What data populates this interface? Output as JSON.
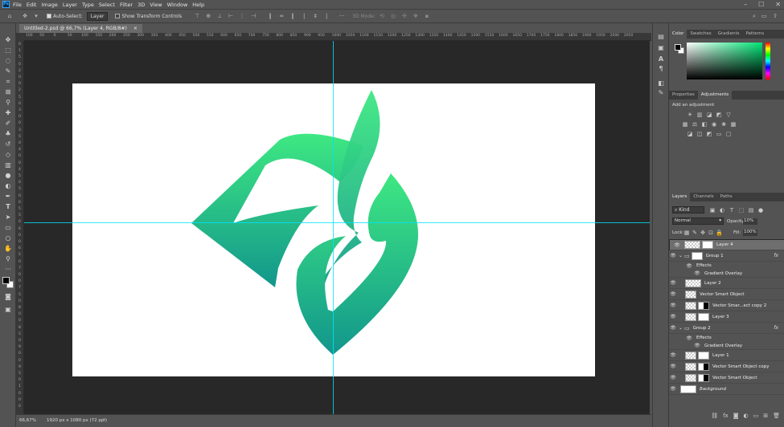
{
  "app": {
    "logo": "Ps"
  },
  "menu": [
    "File",
    "Edit",
    "Image",
    "Layer",
    "Type",
    "Select",
    "Filter",
    "3D",
    "View",
    "Window",
    "Help"
  ],
  "window_controls": [
    "–",
    "☐",
    "✕"
  ],
  "options_bar": {
    "auto_select_label": "Auto-Select:",
    "auto_select_value": "Layer",
    "transform_label": "Show Transform Controls",
    "mode_3d_label": "3D Mode:"
  },
  "document": {
    "tab_title": "Untitled-2.psd @ 66,7% (Layer 4, RGB/8#)",
    "tab_close": "×",
    "zoom": "66,67%",
    "doc_info": "1920 px x 1080 px (72 ppi)"
  },
  "ruler_top_ticks": [
    "100",
    "50",
    "0",
    "50",
    "100",
    "150",
    "200",
    "250",
    "300",
    "350",
    "400",
    "450",
    "500",
    "550",
    "600",
    "650",
    "700",
    "750",
    "800",
    "850",
    "900",
    "950",
    "1000",
    "1050",
    "1100",
    "1150",
    "1200",
    "1250",
    "1300",
    "1350",
    "1400",
    "1450",
    "1500",
    "1550",
    "1600",
    "1650",
    "1700",
    "1750",
    "1800",
    "1850",
    "1900",
    "1950",
    "2000",
    "2050"
  ],
  "ruler_left_ticks": [
    "0",
    "1",
    "5",
    "0",
    "2",
    "0",
    "0",
    "2",
    "5",
    "0",
    "3",
    "0",
    "0",
    "3",
    "5",
    "0",
    "4",
    "0",
    "0",
    "4",
    "5",
    "0",
    "5",
    "0",
    "0",
    "5",
    "5",
    "0",
    "6",
    "0",
    "0",
    "6",
    "5",
    "0",
    "7",
    "0",
    "0",
    "7",
    "5",
    "0",
    "8",
    "0",
    "0",
    "8",
    "5",
    "0",
    "9",
    "0",
    "0",
    "9",
    "5",
    "0",
    "1",
    "0",
    "0",
    "0"
  ],
  "color_panel": {
    "tabs": [
      "Color",
      "Swatches",
      "Gradients",
      "Patterns"
    ],
    "accent": "#00e676"
  },
  "properties_panel": {
    "tabs": [
      "Properties",
      "Adjustments"
    ],
    "add_label": "Add an adjustment"
  },
  "layers_panel": {
    "tabs": [
      "Layers",
      "Channels",
      "Paths"
    ],
    "filter_kind": "Kind",
    "blend_mode": "Normal",
    "opacity_label": "Opacity:",
    "opacity_value": "10%",
    "lock_label": "Lock:",
    "fill_label": "Fill:",
    "fill_value": "100%",
    "layers": [
      {
        "name": "Layer 4",
        "selected": true
      },
      {
        "name": "Group 1",
        "fx": "fx"
      },
      {
        "name": "Effects"
      },
      {
        "name": "Gradient Overlay"
      },
      {
        "name": "Layer 2"
      },
      {
        "name": "Vector Smart Object"
      },
      {
        "name": "Vector Smar...ect copy 2"
      },
      {
        "name": "Layer 3"
      },
      {
        "name": "Group 2",
        "fx": "fx"
      },
      {
        "name": "Effects"
      },
      {
        "name": "Gradient Overlay"
      },
      {
        "name": "Layer 1"
      },
      {
        "name": "Vector Smart Object copy"
      },
      {
        "name": "Vector Smart Object"
      },
      {
        "name": "Background"
      }
    ]
  },
  "colors": {
    "gradient_top": "#3ee882",
    "gradient_bottom": "#12968c",
    "guide": "#00e5ff"
  }
}
